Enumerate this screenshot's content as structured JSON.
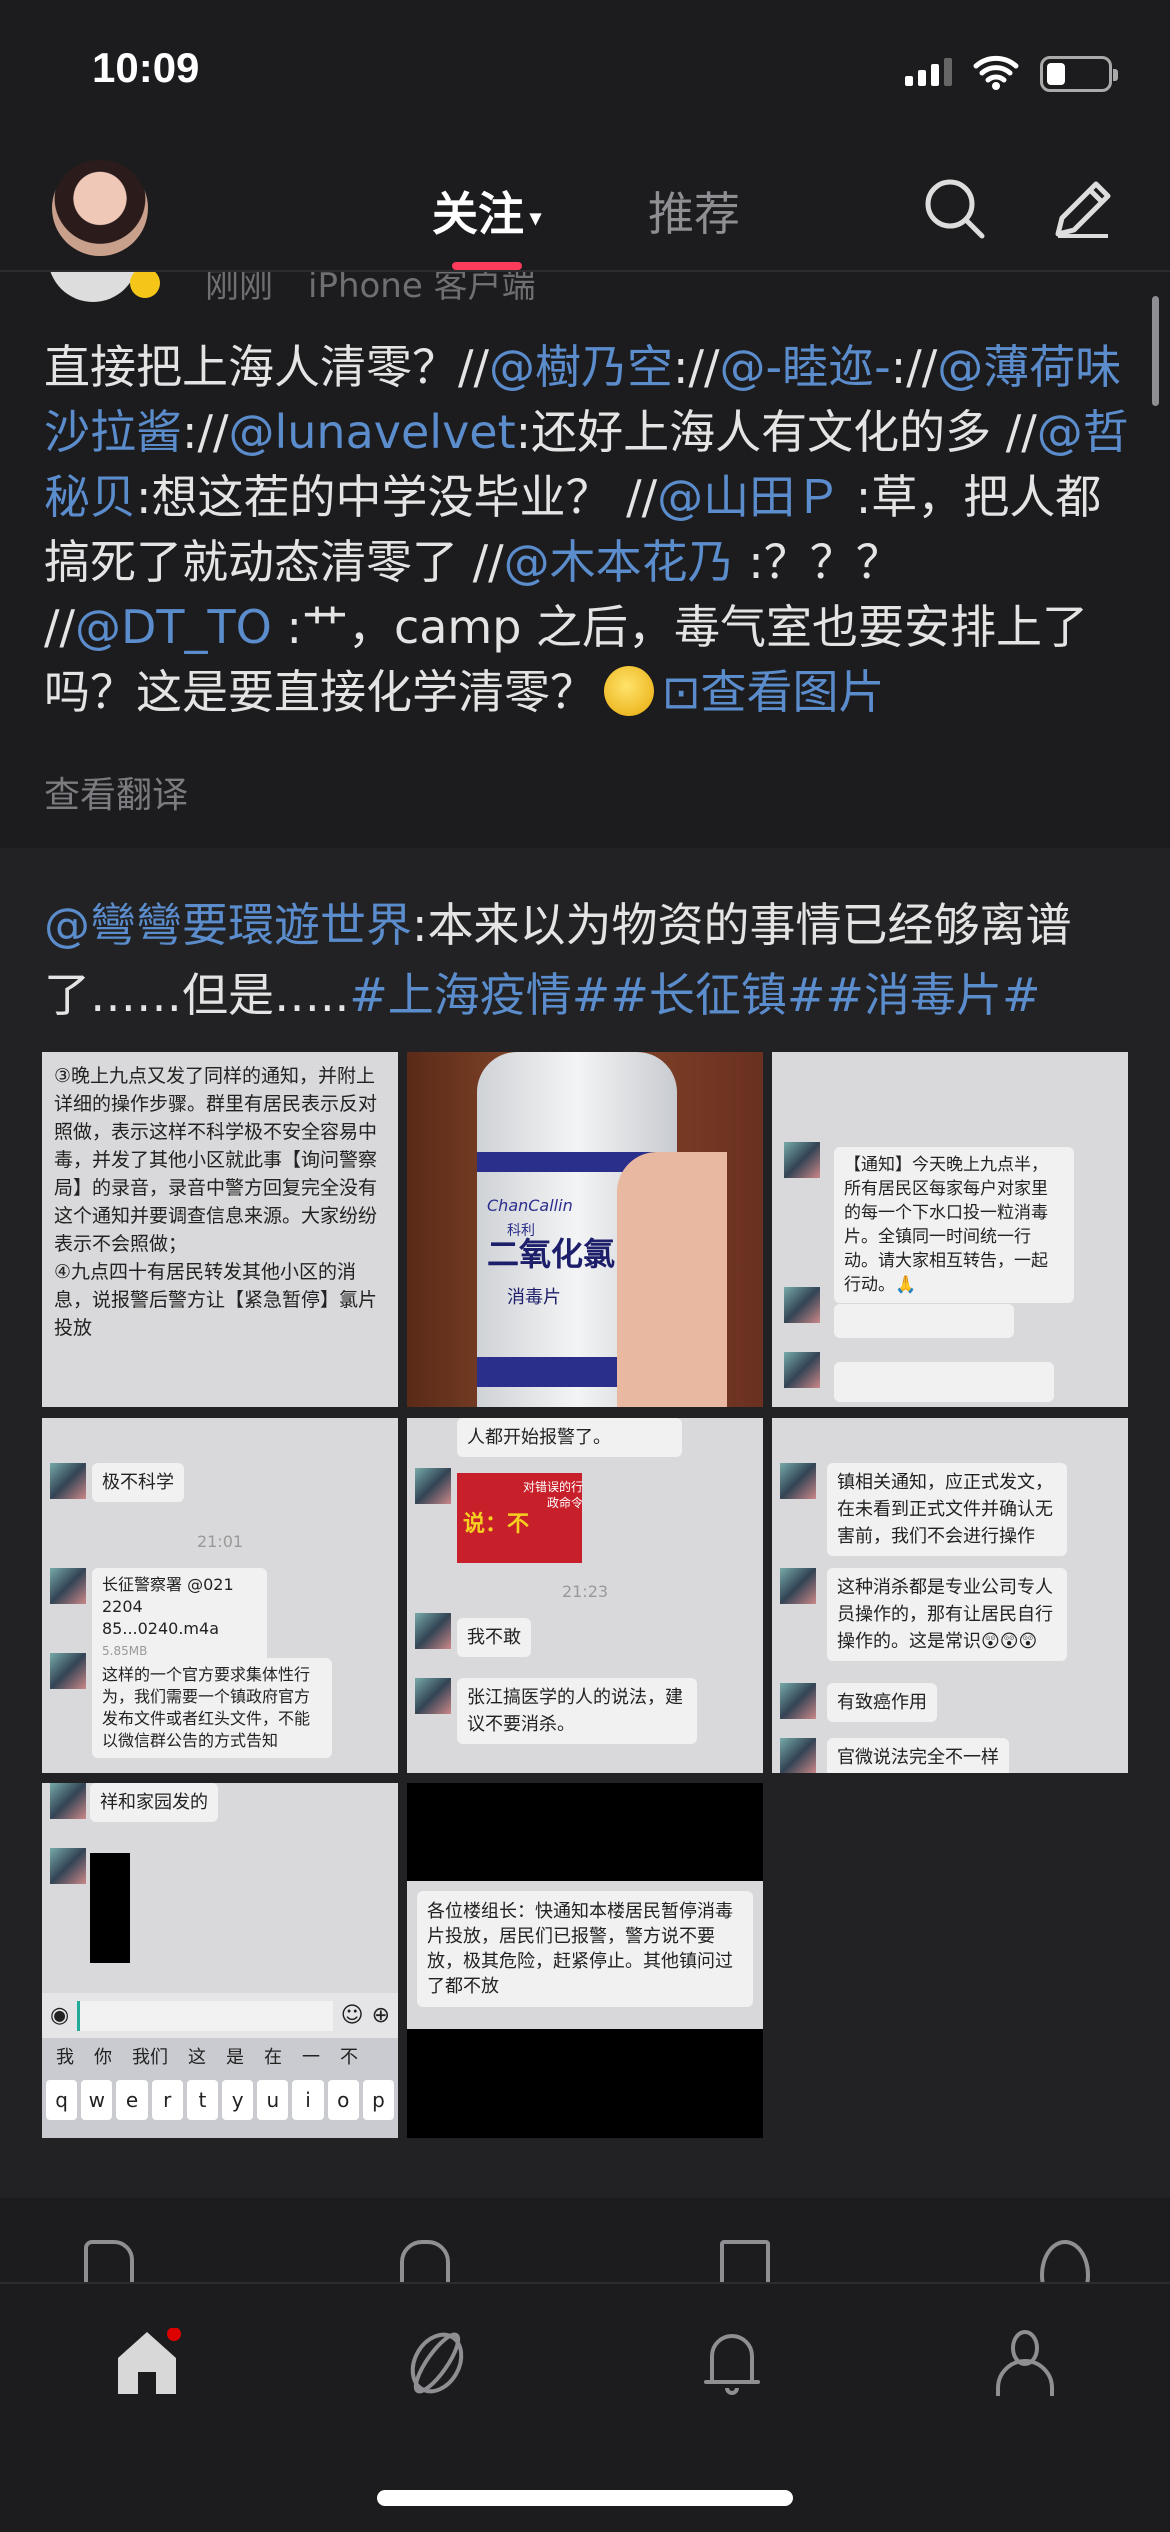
{
  "status": {
    "time": "10:09"
  },
  "header": {
    "tabs": [
      {
        "label": "关注",
        "caret": "▾"
      },
      {
        "label": "推荐"
      }
    ],
    "icons": [
      "search-icon",
      "edit-icon"
    ]
  },
  "post": {
    "time": "刚刚",
    "source": "iPhone 客户端",
    "segments": [
      {
        "t": "直接把上海人清零？//",
        "link": false
      },
      {
        "t": "@樹乃空",
        "link": true
      },
      {
        "t": "://",
        "link": false
      },
      {
        "t": "@-睦迩-",
        "link": true
      },
      {
        "t": "://",
        "link": false
      },
      {
        "t": "@薄荷味沙拉酱",
        "link": true
      },
      {
        "t": "://",
        "link": false
      },
      {
        "t": "@lunavelvet",
        "link": true
      },
      {
        "t": ":还好上海人有文化的多 //",
        "link": false
      },
      {
        "t": "@哲秘贝",
        "link": true
      },
      {
        "t": ":想这茬的中学没毕业？ //",
        "link": false
      },
      {
        "t": "@山田Ｐ",
        "link": true
      },
      {
        "t": " :草，把人都搞死了就动态清零了 //",
        "link": false
      },
      {
        "t": "@木本花乃",
        "link": true
      },
      {
        "t": " :？？？ //",
        "link": false
      },
      {
        "t": "@DT_TO",
        "link": true
      },
      {
        "t": " :艹，camp 之后，毒气室也要安排上了吗？这是要直接化学清零？",
        "link": false
      }
    ],
    "view_images": "⊡查看图片",
    "translate": "查看翻译"
  },
  "retweet": {
    "segments": [
      {
        "t": "@彎彎要環遊世界",
        "link": true
      },
      {
        "t": ":本来以为物资的事情已经够离谱了……但是…..",
        "link": false
      },
      {
        "t": "#上海疫情##长征镇##消毒片#",
        "link": true
      }
    ],
    "images": [
      {
        "kind": "text",
        "lines": [
          "③晚上九点又发了同样的通知，并附上详细的操作步骤。群里有居民表示反对照做，表示这样不科学极不安全容易中毒，并发了其他小区就此事【询问警察局】的录音，录音中警方回复完全没有这个通知并要调查信息来源。大家纷纷表示不会照做；",
          "④九点四十有居民转发其他小区的消息，说报警后警方让【紧急暂停】氯片投放",
          "？？？"
        ]
      },
      {
        "kind": "bottle",
        "brand": "ChanCallin",
        "sub": "科利",
        "name": "二氧化氯",
        "type": "消毒片"
      },
      {
        "kind": "chat",
        "bubbles": [
          "【通知】今天晚上九点半，所有居民区每家每户对家里的每一个下水口投一粒消毒片。全镇同一时间统一行动。请大家相互转告，一起行动。🙏"
        ]
      },
      {
        "kind": "chat",
        "bubbles": [
          "极不科学",
          "长征警察署 @021 2204 85...0240.m4a",
          "这样的一个官方要求集体性行为，我们需要一个镇政府官方发布文件或者红头文件，不能以微信群公告的方式告知"
        ],
        "time": "21:01",
        "filesize": "5.85MB"
      },
      {
        "kind": "chat",
        "bubbles": [
          "人都开始报警了。",
          "我不敢",
          "张江搞医学的人的说法，建议不要消杀。"
        ],
        "time": "21:23",
        "sticker": "说：不",
        "sticker_caption": "对错误的行政命令"
      },
      {
        "kind": "chat",
        "bubbles": [
          "镇相关通知，应正式发文，在未看到正式文件并确认无害前，我们不会进行操作",
          "这种消杀都是专业公司专人员操作的，那有让居民自行操作的。这是常识😲😲😲",
          "有致癌作用",
          "官微说法完全不一样"
        ]
      },
      {
        "kind": "keyboard",
        "bubble": "祥和家园发的",
        "candidates": [
          "我",
          "你",
          "我们",
          "这",
          "是",
          "在",
          "一",
          "不"
        ],
        "keys": [
          "q",
          "w",
          "e",
          "r",
          "t",
          "y",
          "u",
          "i",
          "o",
          "p"
        ]
      },
      {
        "kind": "notice",
        "text": "各位楼组长：快通知本楼居民暂停消毒片投放，居民们已报警，警方说不要放，极其危险，赶紧停止。其他镇问过了都不放"
      }
    ]
  },
  "actions": [
    "like-icon",
    "comment-icon",
    "repost-icon",
    "share-icon"
  ],
  "tabbar": [
    {
      "icon": "home-icon",
      "badge": true
    },
    {
      "icon": "discover-icon"
    },
    {
      "icon": "bell-icon"
    },
    {
      "icon": "profile-icon"
    }
  ],
  "colors": {
    "accent": "#ff3b5c",
    "link": "#5b8ccc",
    "bg": "#1c1c1e"
  }
}
